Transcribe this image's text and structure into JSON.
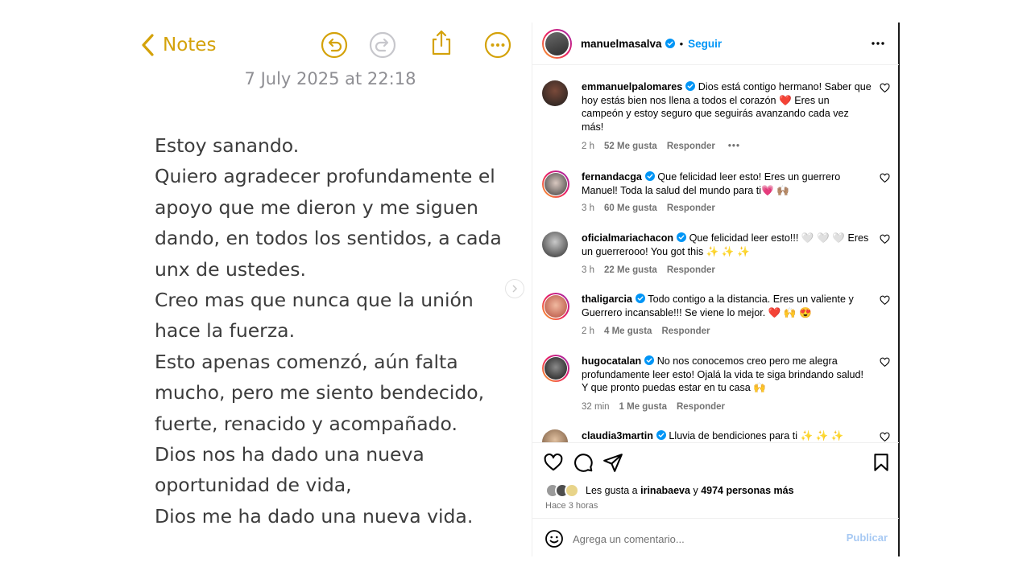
{
  "notes": {
    "back_label": "Notes",
    "date": "7 July 2025 at 22:18",
    "lines": [
      "Estoy sanando.",
      "Quiero agradecer profundamente el",
      "apoyo que me dieron y me siguen",
      "dando, en todos los sentidos, a cada",
      "unx de ustedes.",
      "Creo mas que nunca que la unión",
      "hace la fuerza.",
      "Esto apenas comenzó, aún falta",
      "mucho, pero me siento bendecido,",
      "fuerte, renacido y acompañado.",
      "Dios nos ha dado una nueva",
      "oportunidad de vida,",
      "Dios me ha dado una nueva vida."
    ],
    "accent_color": "#d4a20a"
  },
  "instagram": {
    "header": {
      "username": "manuelmasalva",
      "separator": "•",
      "follow_label": "Seguir"
    },
    "comments": [
      {
        "username": "emmanuelpalomares",
        "text": "Dios está contigo hermano! Saber que hoy estás bien nos llena a todos el corazón ❤️ Eres un campeón y estoy seguro que seguirás avanzando cada vez más!",
        "time": "2 h",
        "likes": "52 Me gusta",
        "reply": "Responder",
        "more": "•••"
      },
      {
        "username": "fernandacga",
        "text": "Que felicidad leer esto! Eres un guerrero Manuel! Toda la salud del mundo para ti💗 🙌🏽",
        "time": "3 h",
        "likes": "60 Me gusta",
        "reply": "Responder"
      },
      {
        "username": "oficialmariachacon",
        "text": "Que felicidad leer esto!!! 🤍 🤍 🤍 Eres un guerrerooo! You got this ✨ ✨ ✨",
        "time": "3 h",
        "likes": "22 Me gusta",
        "reply": "Responder"
      },
      {
        "username": "thaligarcia",
        "text": "Todo contigo a la distancia. Eres un valiente y Guerrero incansable!!! Se viene lo mejor. ❤️ 🙌 😍",
        "time": "2 h",
        "likes": "4 Me gusta",
        "reply": "Responder"
      },
      {
        "username": "hugocatalan",
        "text": "No nos conocemos creo pero me alegra profundamente leer esto! Ojalá la vida te siga brindando salud! Y que pronto puedas estar en tu casa 🙌",
        "time": "32 min",
        "likes": "1 Me gusta",
        "reply": "Responder"
      },
      {
        "username": "claudia3martin",
        "text": "Lluvia de bendiciones para ti ✨ ✨ ✨"
      }
    ],
    "likes": {
      "prefix": "Les gusta a",
      "user": "irinabaeva",
      "joiner": "y",
      "others": "4974 personas más"
    },
    "time_ago": "Hace 3 horas",
    "comment_placeholder": "Agrega un comentario...",
    "publish_label": "Publicar",
    "colors": {
      "link": "#0095f6",
      "verified": "#0095f6",
      "muted": "#737373"
    }
  }
}
